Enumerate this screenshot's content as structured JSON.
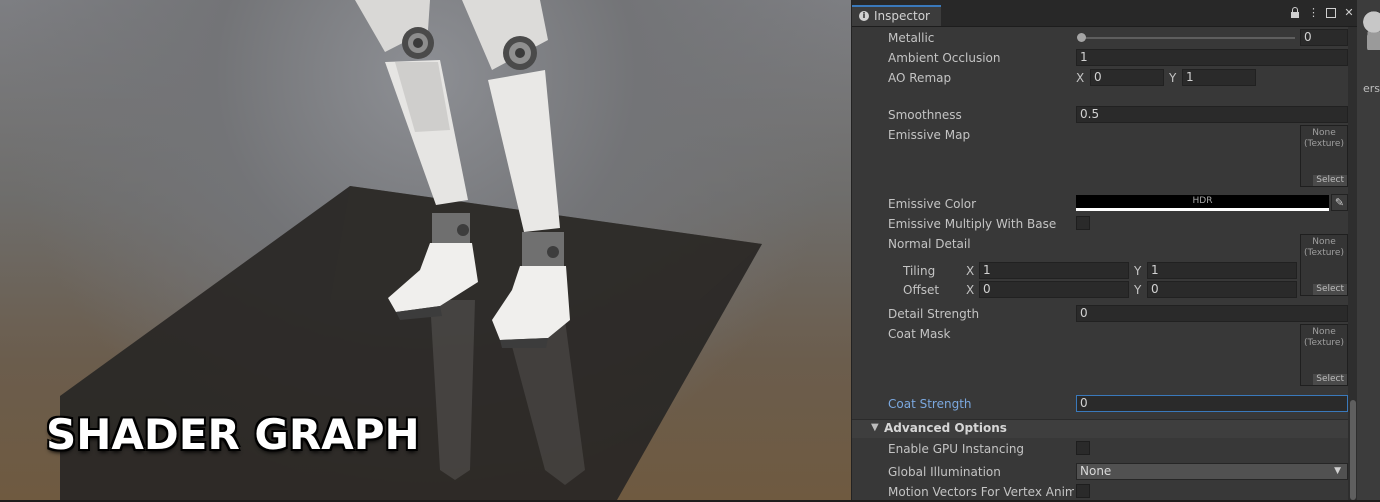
{
  "viewport": {
    "overlay_title": "SHADER GRAPH"
  },
  "inspector": {
    "tab_label": "Inspector",
    "tab_icons": [
      "info-icon",
      "lock-icon",
      "menu-icon",
      "maximize-icon",
      "close-icon"
    ],
    "metallic": {
      "label": "Metallic",
      "value": "0",
      "slider_fraction": 0
    },
    "ambient_occlusion": {
      "label": "Ambient Occlusion",
      "value": "1"
    },
    "ao_remap": {
      "label": "AO Remap",
      "x_label": "X",
      "x_value": "0",
      "y_label": "Y",
      "y_value": "1"
    },
    "smoothness": {
      "label": "Smoothness",
      "value": "0.5"
    },
    "emissive_map": {
      "label": "Emissive Map",
      "slot_text": "None\n(Texture)",
      "select": "Select"
    },
    "emissive_color": {
      "label": "Emissive Color",
      "hdr": "HDR",
      "color": "#000000"
    },
    "emissive_multiply": {
      "label": "Emissive Multiply With Base",
      "checked": false
    },
    "normal_detail": {
      "label": "Normal Detail",
      "slot_text": "None\n(Texture)",
      "select": "Select",
      "tiling": {
        "label": "Tiling",
        "x_label": "X",
        "x_value": "1",
        "y_label": "Y",
        "y_value": "1"
      },
      "offset": {
        "label": "Offset",
        "x_label": "X",
        "x_value": "0",
        "y_label": "Y",
        "y_value": "0"
      }
    },
    "detail_strength": {
      "label": "Detail Strength",
      "value": "0"
    },
    "coat_mask": {
      "label": "Coat Mask",
      "slot_text": "None\n(Texture)",
      "select": "Select"
    },
    "coat_strength": {
      "label": "Coat Strength",
      "value": "0"
    },
    "advanced_options": {
      "header": "Advanced Options",
      "gpu_instancing": {
        "label": "Enable GPU Instancing",
        "checked": false
      },
      "global_illumination": {
        "label": "Global Illumination",
        "selected": "None"
      },
      "motion_vectors": {
        "label": "Motion Vectors For Vertex Animati",
        "checked": false
      }
    }
  },
  "side_strip": {
    "fragment": "ers"
  },
  "colors": {
    "accent": "#3a79bb",
    "active_label": "#7ba8df",
    "panel": "#383838"
  }
}
